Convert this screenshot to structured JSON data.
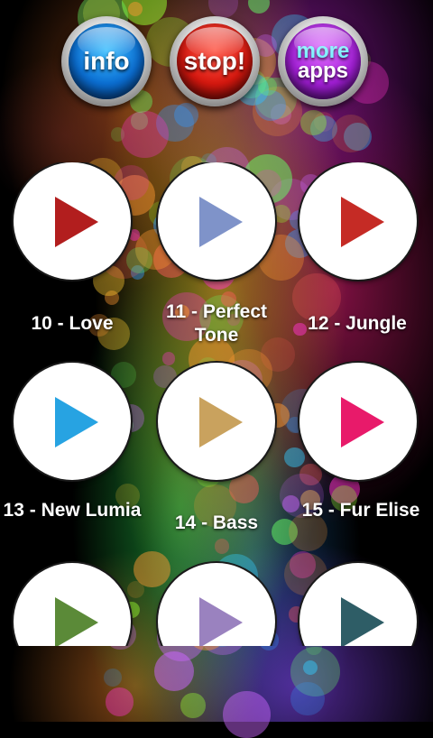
{
  "top_buttons": {
    "info": {
      "label": "info",
      "color": "#0b6fd4"
    },
    "stop": {
      "label": "stop!",
      "color": "#d8180f"
    },
    "more": {
      "line1": "more",
      "line2": "apps",
      "color": "#a41fd8"
    }
  },
  "sounds": [
    {
      "label": "10 - Love",
      "color": "#b21e1e",
      "icon": "play-icon"
    },
    {
      "label": "11 - Perfect Tone",
      "color": "#7f93c9",
      "icon": "play-icon"
    },
    {
      "label": "12 - Jungle",
      "color": "#c52b25",
      "icon": "play-icon"
    },
    {
      "label": "13 - New Lumia",
      "color": "#27a3e2",
      "icon": "play-icon"
    },
    {
      "label": "14 - Bass",
      "color": "#c9a25e",
      "icon": "play-icon"
    },
    {
      "label": "15 - Fur Elise",
      "color": "#e81a6a",
      "icon": "play-icon"
    },
    {
      "label": "",
      "color": "#5b8a38",
      "icon": "play-icon"
    },
    {
      "label": "",
      "color": "#9a82bf",
      "icon": "play-icon"
    },
    {
      "label": "",
      "color": "#2e5d66",
      "icon": "play-icon"
    }
  ]
}
